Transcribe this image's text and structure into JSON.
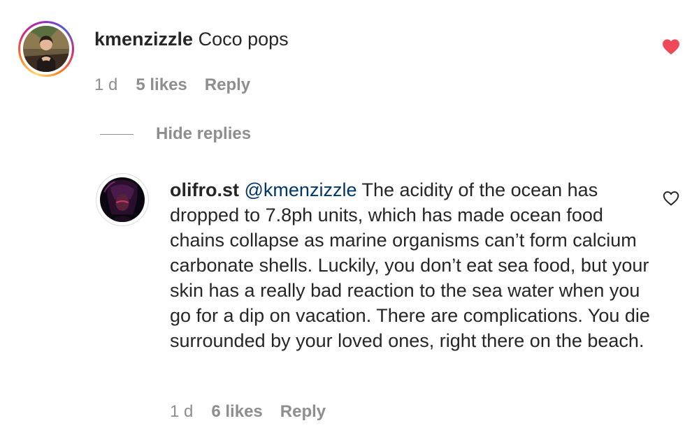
{
  "comments": [
    {
      "username": "kmenzizzle",
      "text": "Coco pops",
      "time": "1 d",
      "likes": "5 likes",
      "reply_label": "Reply",
      "liked": true
    }
  ],
  "replies_toggle": {
    "label": "Hide replies"
  },
  "replies": [
    {
      "username": "olifro.st",
      "mention": "@kmenzizzle",
      "text": "The acidity of the ocean has dropped to 7.8ph units, which has made ocean food chains collapse as marine organisms can’t form calcium carbonate shells. Luckily, you don’t eat sea food, but your skin has a really bad reaction to the sea water when you go for a dip on vacation. There are complications. You die surrounded by your loved ones, right there on the beach.",
      "time": "1 d",
      "likes": "6 likes",
      "reply_label": "Reply",
      "liked": false
    }
  ],
  "icons": {
    "liked_heart": "heart-filled-icon",
    "unliked_heart": "heart-outline-icon"
  },
  "colors": {
    "text": "#262626",
    "secondary": "#8e8e8e",
    "mention": "#00376b",
    "like_red": "#ed4956"
  }
}
